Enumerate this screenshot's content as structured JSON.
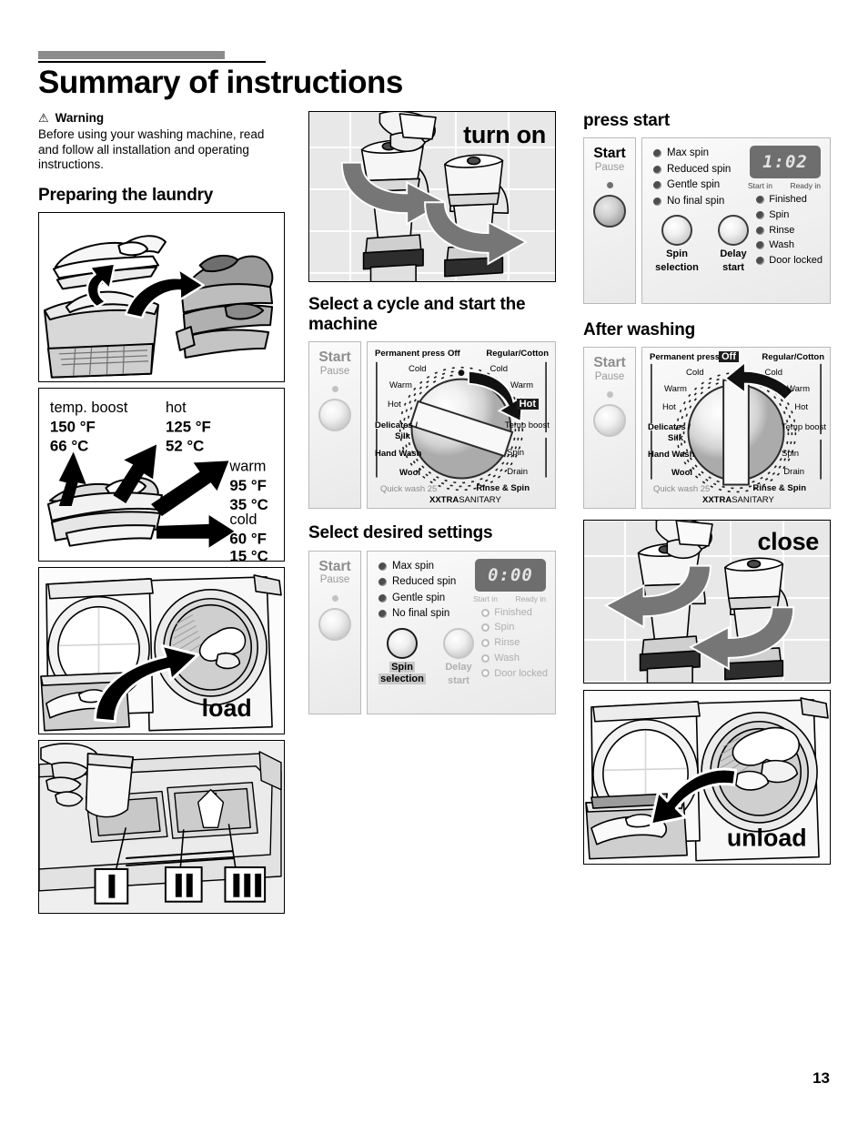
{
  "page": {
    "title": "Summary of instructions",
    "number": "13"
  },
  "warning": {
    "icon": "warning-triangle",
    "label": "Warning",
    "body": "Before using your washing machine, read and follow all installation and operating instructions."
  },
  "sections": {
    "preparing_laundry": "Preparing the laundry",
    "select_cycle": "Select a cycle and start the machine",
    "select_settings": "Select desired settings",
    "press_start": "press start",
    "after_washing": "After washing"
  },
  "figures": {
    "sort_laundry": {
      "caption": ""
    },
    "turn_on": {
      "caption": "turn on"
    },
    "load": {
      "caption": "load"
    },
    "detergent": {
      "caption": "",
      "compartments": [
        "I",
        "II",
        "III"
      ]
    },
    "close": {
      "caption": "close"
    },
    "unload": {
      "caption": "unload"
    }
  },
  "temperature_chart": {
    "entries": [
      {
        "name": "temp. boost",
        "f": "150 °F",
        "c": "66 °C"
      },
      {
        "name": "hot",
        "f": "125 °F",
        "c": "52 °C"
      },
      {
        "name": "warm",
        "f": "95 °F",
        "c": "35 °C"
      },
      {
        "name": "cold",
        "f": "60 °F",
        "c": "15 °C"
      }
    ]
  },
  "control_panel": {
    "start_label": "Start",
    "pause_label": "Pause",
    "spin_options": [
      "Max spin",
      "Reduced spin",
      "Gentle spin",
      "No final spin"
    ],
    "stage_options": [
      "Finished",
      "Spin",
      "Rinse",
      "Wash",
      "Door locked"
    ],
    "display_sub_left": "Start in",
    "display_sub_right": "Ready in",
    "button_spin_line1": "Spin",
    "button_spin_line2": "selection",
    "button_delay_line1": "Delay",
    "button_delay_line2": "start"
  },
  "panel_press_start": {
    "display_value": "1:02"
  },
  "panel_settings": {
    "display_value": "0:00"
  },
  "dial": {
    "labels_left_top": "Permanent press",
    "labels_right_top": "Regular/Cotton",
    "left_temps": [
      "Cold",
      "Warm",
      "Hot"
    ],
    "right_temps": [
      "Cold",
      "Warm",
      "Hot",
      "Temp boost"
    ],
    "off": "Off",
    "delicates": "Delicates /",
    "silk": "Silk",
    "hand_wash": "Hand Wash",
    "wool": "Wool",
    "quick_wash": "Quick wash 25",
    "rinse_spin": "Rinse & Spin",
    "spin": "Spin",
    "drain": "Drain",
    "xxtra": "XXTRA",
    "sanitary": "SANITARY",
    "selected_cycle": "Hot",
    "selected_off": "Off"
  },
  "colors": {
    "rule_gray": "#8c8c8c",
    "panel_bg": "#f2f2f2",
    "display_bg": "#6e6e6e",
    "led_on": "#4d4d4d"
  }
}
